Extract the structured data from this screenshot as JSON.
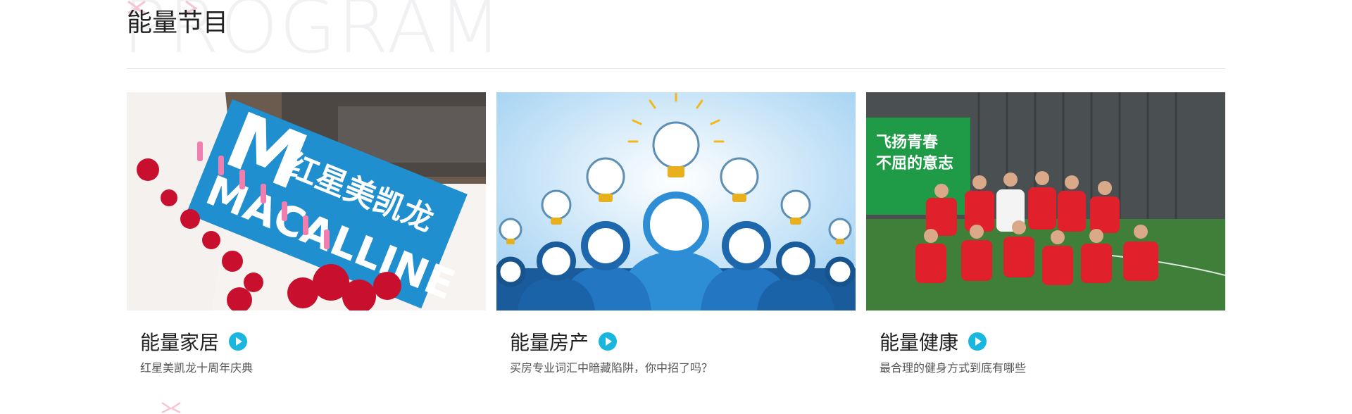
{
  "section": {
    "title": "能量节目",
    "bg_word": "PROGRAM"
  },
  "cards": [
    {
      "title": "能量家居",
      "subtitle": "红星美凯龙十周年庆典",
      "image": {
        "sign_cn": "红星美凯龙",
        "sign_en": "MACALLINE"
      }
    },
    {
      "title": "能量房产",
      "subtitle": "买房专业词汇中暗藏陷阱，你中招了吗？"
    },
    {
      "title": "能量健康",
      "subtitle": "最合理的健身方式到底有哪些",
      "image": {
        "banner_line1": "飞扬青春",
        "banner_line2": "不屈的意志"
      }
    }
  ],
  "colors": {
    "accent": "#19b6e0",
    "sign_blue": "#1f8fd0",
    "jersey_red": "#e0202a",
    "banner_green": "#1f9a46"
  }
}
